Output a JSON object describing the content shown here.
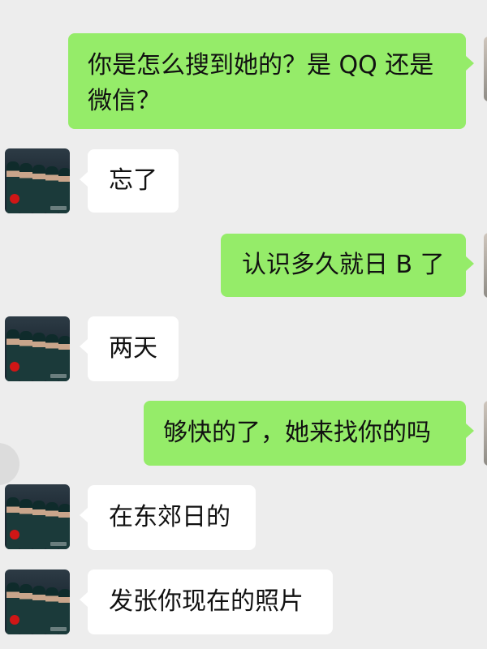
{
  "chat": {
    "messages": [
      {
        "side": "out",
        "text1": "你是怎么搜到她的？是 QQ 还是",
        "text2": "微信？"
      },
      {
        "side": "in",
        "text": "忘了"
      },
      {
        "side": "out",
        "text": "认识多久就日 B 了"
      },
      {
        "side": "in",
        "text": "两天"
      },
      {
        "side": "out",
        "text": "够快的了，她来找你的吗"
      },
      {
        "side": "in",
        "text": "在东郊日的"
      },
      {
        "side": "in",
        "text": "发张你现在的照片"
      }
    ]
  },
  "colors": {
    "background": "#ededed",
    "outgoing_bubble": "#95ec69",
    "incoming_bubble": "#ffffff",
    "text": "#111111"
  },
  "icons": {
    "contact_avatar": "military-parade-avatar-icon",
    "self_avatar": "self-avatar-icon"
  }
}
